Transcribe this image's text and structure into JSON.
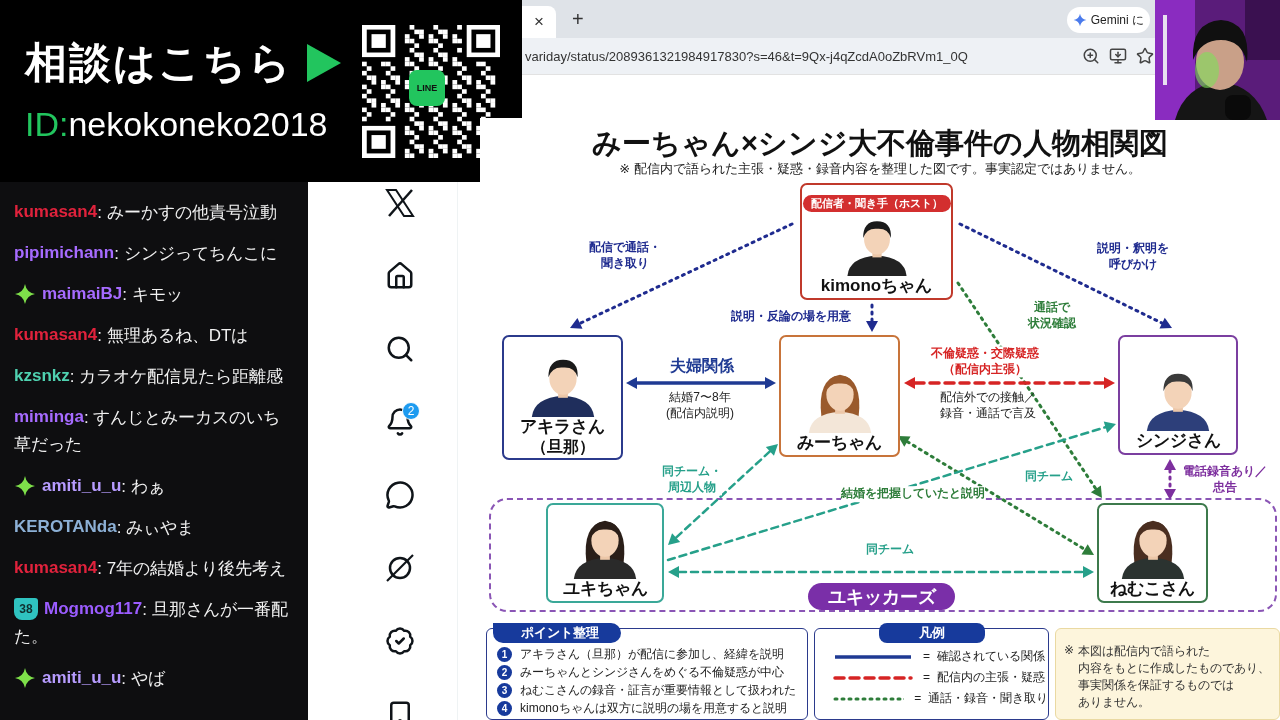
{
  "promo": {
    "heading": "相談はこちら",
    "id_prefix": "ID:",
    "id_value": "nekokoneko2018",
    "qr_badge": "LINE"
  },
  "browser": {
    "tab_close": "×",
    "new_tab": "+",
    "gemini_button": "Gemini に",
    "url": "variday/status/2089361321984917830?s=46&t=9Qx-j4qZcdA0oZbRVm1_0Q"
  },
  "sidebar": {
    "items": [
      {
        "kind": "logo"
      },
      {
        "kind": "home"
      },
      {
        "kind": "search"
      },
      {
        "kind": "notifications",
        "badge": "2"
      },
      {
        "kind": "messages"
      },
      {
        "kind": "grok"
      },
      {
        "kind": "verified"
      },
      {
        "kind": "bookmarks"
      }
    ]
  },
  "chat": {
    "messages": [
      {
        "user": "kumasan4",
        "color": "#e0223c",
        "separator": ":",
        "text": "みーかすの他責号泣動"
      },
      {
        "user": "pipimichann",
        "color": "#a66bff",
        "separator": ":",
        "text": "シンジってちんこに"
      },
      {
        "kind": "sparkle",
        "user": "maimaiBJ",
        "color": "#a66bff",
        "separator": ":",
        "text": "キモッ"
      },
      {
        "user": "kumasan4",
        "color": "#e0223c",
        "separator": ":",
        "text": "無理あるね、DTは"
      },
      {
        "user": "kzsnkz",
        "color": "#4fd1b0",
        "separator": ":",
        "text": "カラオケ配信見たら距離感"
      },
      {
        "user": "miminga",
        "color": "#a66bff",
        "separator": ":",
        "text": "すんじとみーカスのいち",
        "continued": "草だった"
      },
      {
        "kind": "sparkle",
        "user": "amiti_u_u",
        "color": "#b79cff",
        "separator": ":",
        "text": "わぁ"
      },
      {
        "user": "KEROTANda",
        "color": "#8cb0d6",
        "separator": ":",
        "text": "みぃやま"
      },
      {
        "user": "kumasan4",
        "color": "#e0223c",
        "separator": ":",
        "text": "7年の結婚より後先考え"
      },
      {
        "kind": "subscriber",
        "badge_text": "38",
        "user": "Mogmog117",
        "color": "#9b5cff",
        "separator": ":",
        "text": "旦那さんが一番配",
        "continued": "た。"
      },
      {
        "kind": "sparkle",
        "user": "amiti_u_u",
        "color": "#b79cff",
        "separator": ":",
        "text": "やば"
      }
    ]
  },
  "diagram": {
    "title": "みーちゃん×シンジ大不倫事件の人物相関図",
    "subtitle": "※ 配信内で語られた主張・疑惑・録音内容を整理した図です。事実認定ではありません。",
    "people": [
      {
        "name": "kimonoちゃん",
        "tag": "配信者・聞き手（ホスト）",
        "color": "#c0392b"
      },
      {
        "name": "アキラさん",
        "note": "（旦那）",
        "color": "#2b3a8c"
      },
      {
        "name": "みーちゃん",
        "color": "#c8743a"
      },
      {
        "name": "シンジさん",
        "color": "#7b3fa0"
      },
      {
        "name": "ユキちゃん",
        "color": "#3aa898"
      },
      {
        "name": "ねむこさん",
        "color": "#3d7a4c"
      }
    ],
    "links": [
      {
        "kind": "host",
        "both_ways": false,
        "label": [
          "配信で通話・",
          "聞き取り"
        ]
      },
      {
        "kind": "host",
        "both_ways": false,
        "label": [
          "説明・釈明を",
          "呼びかけ"
        ]
      },
      {
        "kind": "host",
        "both_ways": false,
        "label": [
          "説明・反論の場を用意"
        ]
      },
      {
        "kind": "call",
        "both_ways": false,
        "label": [
          "通話で",
          "状況確認"
        ]
      },
      {
        "kind": "confirmed",
        "both_ways": true,
        "label": [
          "夫婦関係"
        ],
        "note": [
          "結婚7〜8年",
          "(配信内説明)"
        ]
      },
      {
        "kind": "claim",
        "both_ways": true,
        "label": [
          "不倫疑惑・交際疑惑",
          "（配信内主張）"
        ],
        "note": [
          "配信外での接触／",
          "録音・通話で言及"
        ]
      },
      {
        "kind": "team",
        "both_ways": true,
        "label": [
          "同チーム・",
          "周辺人物"
        ]
      },
      {
        "kind": "call",
        "both_ways": true,
        "label": [
          "結婚を把握していたと説明"
        ]
      },
      {
        "kind": "team",
        "both_ways": false,
        "label": [
          "同チーム"
        ]
      },
      {
        "kind": "team",
        "both_ways": true,
        "label": [
          "同チーム"
        ]
      },
      {
        "kind": "recording",
        "both_ways": true,
        "label": [
          "電話録音あり／",
          "忠告"
        ]
      }
    ],
    "group": {
      "label": "ユキッカーズ"
    },
    "points": {
      "title": "ポイント整理",
      "items": [
        {
          "number": "1",
          "text": "アキラさん（旦那）が配信に参加し、経緯を説明"
        },
        {
          "number": "2",
          "text": "みーちゃんとシンジさんをめぐる不倫疑惑が中心"
        },
        {
          "number": "3",
          "text": "ねむこさんの録音・証言が重要情報として扱われた"
        },
        {
          "number": "4",
          "text": "kimonoちゃんは双方に説明の場を用意すると説明"
        }
      ]
    },
    "legend": {
      "title": "凡例",
      "items": [
        {
          "kind": "confirmed",
          "equals": "=",
          "text": "確認されている関係"
        },
        {
          "kind": "claim",
          "equals": "=",
          "text": "配信内の主張・疑惑"
        },
        {
          "kind": "call",
          "equals": "=",
          "text": "通話・録音・聞き取り"
        }
      ]
    },
    "disclaimer": {
      "mark": "※",
      "lines": [
        "本図は配信内で語られた",
        "内容をもとに作成したものであり、",
        "事実関係を保証するものでは",
        "ありません。"
      ]
    }
  }
}
